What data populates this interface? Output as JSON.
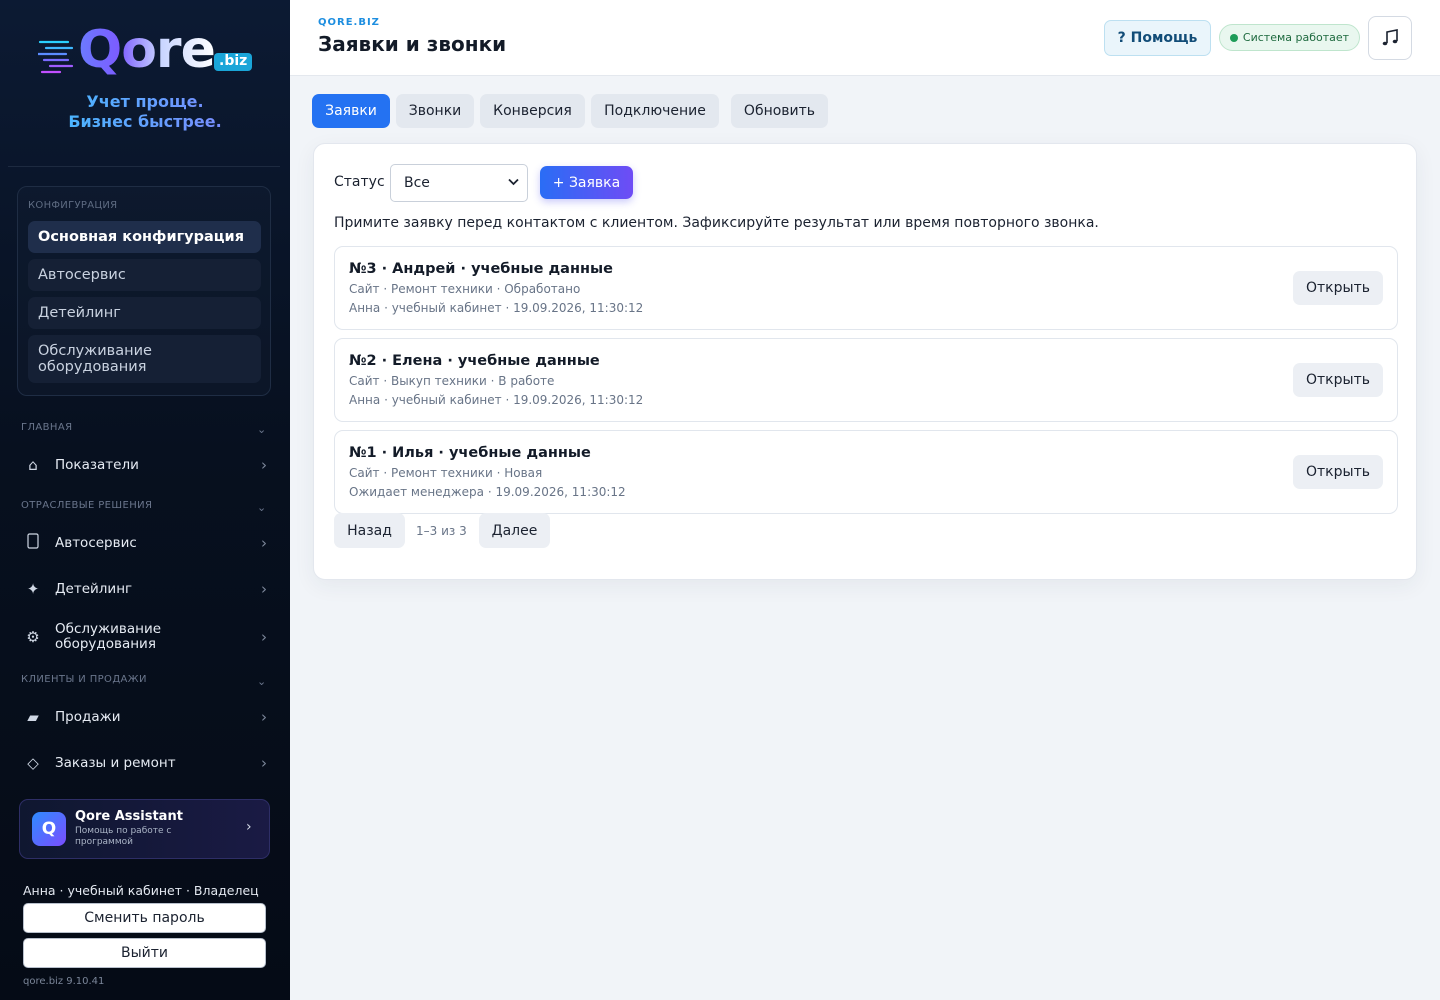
{
  "brand": {
    "logo_text": "Qore",
    "logo_suffix": ".biz",
    "tagline": "Учет проще. Бизнес быстрее."
  },
  "config": {
    "title": "КОНФИГУРАЦИЯ",
    "items": [
      {
        "label": "Основная конфигурация",
        "active": true
      },
      {
        "label": "Автосервис"
      },
      {
        "label": "Детейлинг"
      },
      {
        "label": "Обслуживание оборудования"
      }
    ]
  },
  "nav": {
    "sections": [
      {
        "title": "ГЛАВНАЯ",
        "items": [
          {
            "label": "Показатели",
            "icon": "home-icon"
          }
        ]
      },
      {
        "title": "ОТРАСЛЕВЫЕ РЕШЕНИЯ",
        "items": [
          {
            "label": "Автосервис",
            "icon": "car-icon"
          },
          {
            "label": "Детейлинг",
            "icon": "sparkle-icon"
          },
          {
            "label": "Обслуживание оборудования",
            "icon": "gear-icon"
          }
        ]
      },
      {
        "title": "КЛИЕНТЫ И ПРОДАЖИ",
        "items": [
          {
            "label": "Продажи",
            "icon": "tag-icon"
          },
          {
            "label": "Заказы и ремонт",
            "icon": "diamond-icon"
          }
        ]
      }
    ]
  },
  "assistant": {
    "logo": "Q",
    "title": "Qore Assistant",
    "subtitle": "Помощь по работе с программой"
  },
  "user": {
    "line": "Анна · учебный кабинет · Владелец",
    "change_password": "Сменить пароль",
    "logout": "Выйти",
    "version": "qore.biz 9.10.41"
  },
  "header": {
    "brand": "QORE.BIZ",
    "title": "Заявки и звонки",
    "help": "? Помощь",
    "status": "Система работает",
    "music_icon": "music-note-icon"
  },
  "tabs": [
    {
      "label": "Заявки",
      "active": true
    },
    {
      "label": "Звонки"
    },
    {
      "label": "Конверсия"
    },
    {
      "label": "Подключение"
    },
    {
      "label": "Обновить"
    }
  ],
  "filter": {
    "label": "Статус",
    "selected": "Все",
    "add_button": "+ Заявка"
  },
  "hint": "Примите заявку перед контактом с клиентом. Зафиксируйте результат или время повторного звонка.",
  "leads": [
    {
      "title": "№3 · Андрей · учебные данные",
      "meta": "Сайт · Ремонт техники · Обработано",
      "meta2": "Анна · учебный кабинет · 19.09.2026, 11:30:12",
      "action": "Открыть"
    },
    {
      "title": "№2 · Елена · учебные данные",
      "meta": "Сайт · Выкуп техники · В работе",
      "meta2": "Анна · учебный кабинет · 19.09.2026, 11:30:12",
      "action": "Открыть"
    },
    {
      "title": "№1 · Илья · учебные данные",
      "meta": "Сайт · Ремонт техники · Новая",
      "meta2": "Ожидает менеджера · 19.09.2026, 11:30:12",
      "action": "Открыть"
    }
  ],
  "pager": {
    "prev": "Назад",
    "info": "1–3 из 3",
    "next": "Далее"
  },
  "colors": {
    "accent": "#2472f2",
    "sidebar_bg": "#07101f",
    "status_green": "#1e9c59",
    "brand_blue": "#1d8ee0"
  }
}
